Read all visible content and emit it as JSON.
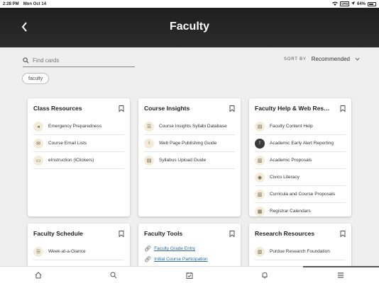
{
  "status_bar": {
    "time": "2:28 PM",
    "date": "Mon Oct 14",
    "vpn": "VPN",
    "battery": "64%"
  },
  "header": {
    "title": "Faculty",
    "back_icon": "chevron-left-icon"
  },
  "search": {
    "placeholder": "Find cards",
    "value": ""
  },
  "sort": {
    "label": "SORT BY",
    "value": "Recommended"
  },
  "filter_chip": "faculty",
  "cards": {
    "class_resources": {
      "title": "Class Resources",
      "items": [
        {
          "label": "Emergency Preparedness",
          "icon": "megaphone-icon"
        },
        {
          "label": "Course Email Lists",
          "icon": "envelope-icon"
        },
        {
          "label": "eInstruction (iClickers)",
          "icon": "monitor-icon"
        }
      ]
    },
    "course_insights": {
      "title": "Course Insights",
      "items": [
        {
          "label": "Course Insights Syllabi Database",
          "icon": "list-icon"
        },
        {
          "label": "Web Page Publishing Guide",
          "icon": "info-icon"
        },
        {
          "label": "Syllabus Upload Guide",
          "icon": "document-icon"
        }
      ]
    },
    "faculty_help": {
      "title": "Faculty Help & Web Res…",
      "items": [
        {
          "label": "Faculty Content Help",
          "icon": "document-icon"
        },
        {
          "label": "Academic Early Alert Reporting",
          "icon": "alert-icon"
        },
        {
          "label": "Academic Proposals",
          "icon": "clipboard-icon"
        },
        {
          "label": "Civics Literacy",
          "icon": "chat-icon"
        },
        {
          "label": "Curricula and Course Proposals",
          "icon": "clipboard-icon"
        },
        {
          "label": "Registrar Calendars",
          "icon": "calendar-icon"
        }
      ]
    },
    "faculty_schedule": {
      "title": "Faculty Schedule",
      "items": [
        {
          "label": "Week-at-a-Glance",
          "icon": "list-icon"
        }
      ]
    },
    "faculty_tools": {
      "title": "Faculty Tools",
      "items": [
        {
          "label": "Faculty Grade Entry",
          "icon": "link-icon"
        },
        {
          "label": "Initial Course Participation",
          "icon": "link-icon"
        }
      ]
    },
    "research_resources": {
      "title": "Research Resources",
      "items": [
        {
          "label": "Purdue Research Foundation",
          "icon": "clipboard-icon"
        }
      ]
    }
  },
  "tab_bar": [
    "home-icon",
    "search-icon",
    "calendar-check-icon",
    "bell-icon",
    "menu-icon"
  ],
  "colors": {
    "header": "#262626",
    "background": "#efefef",
    "icon_circle": "#f3ecda",
    "link": "#2a6aa8"
  }
}
